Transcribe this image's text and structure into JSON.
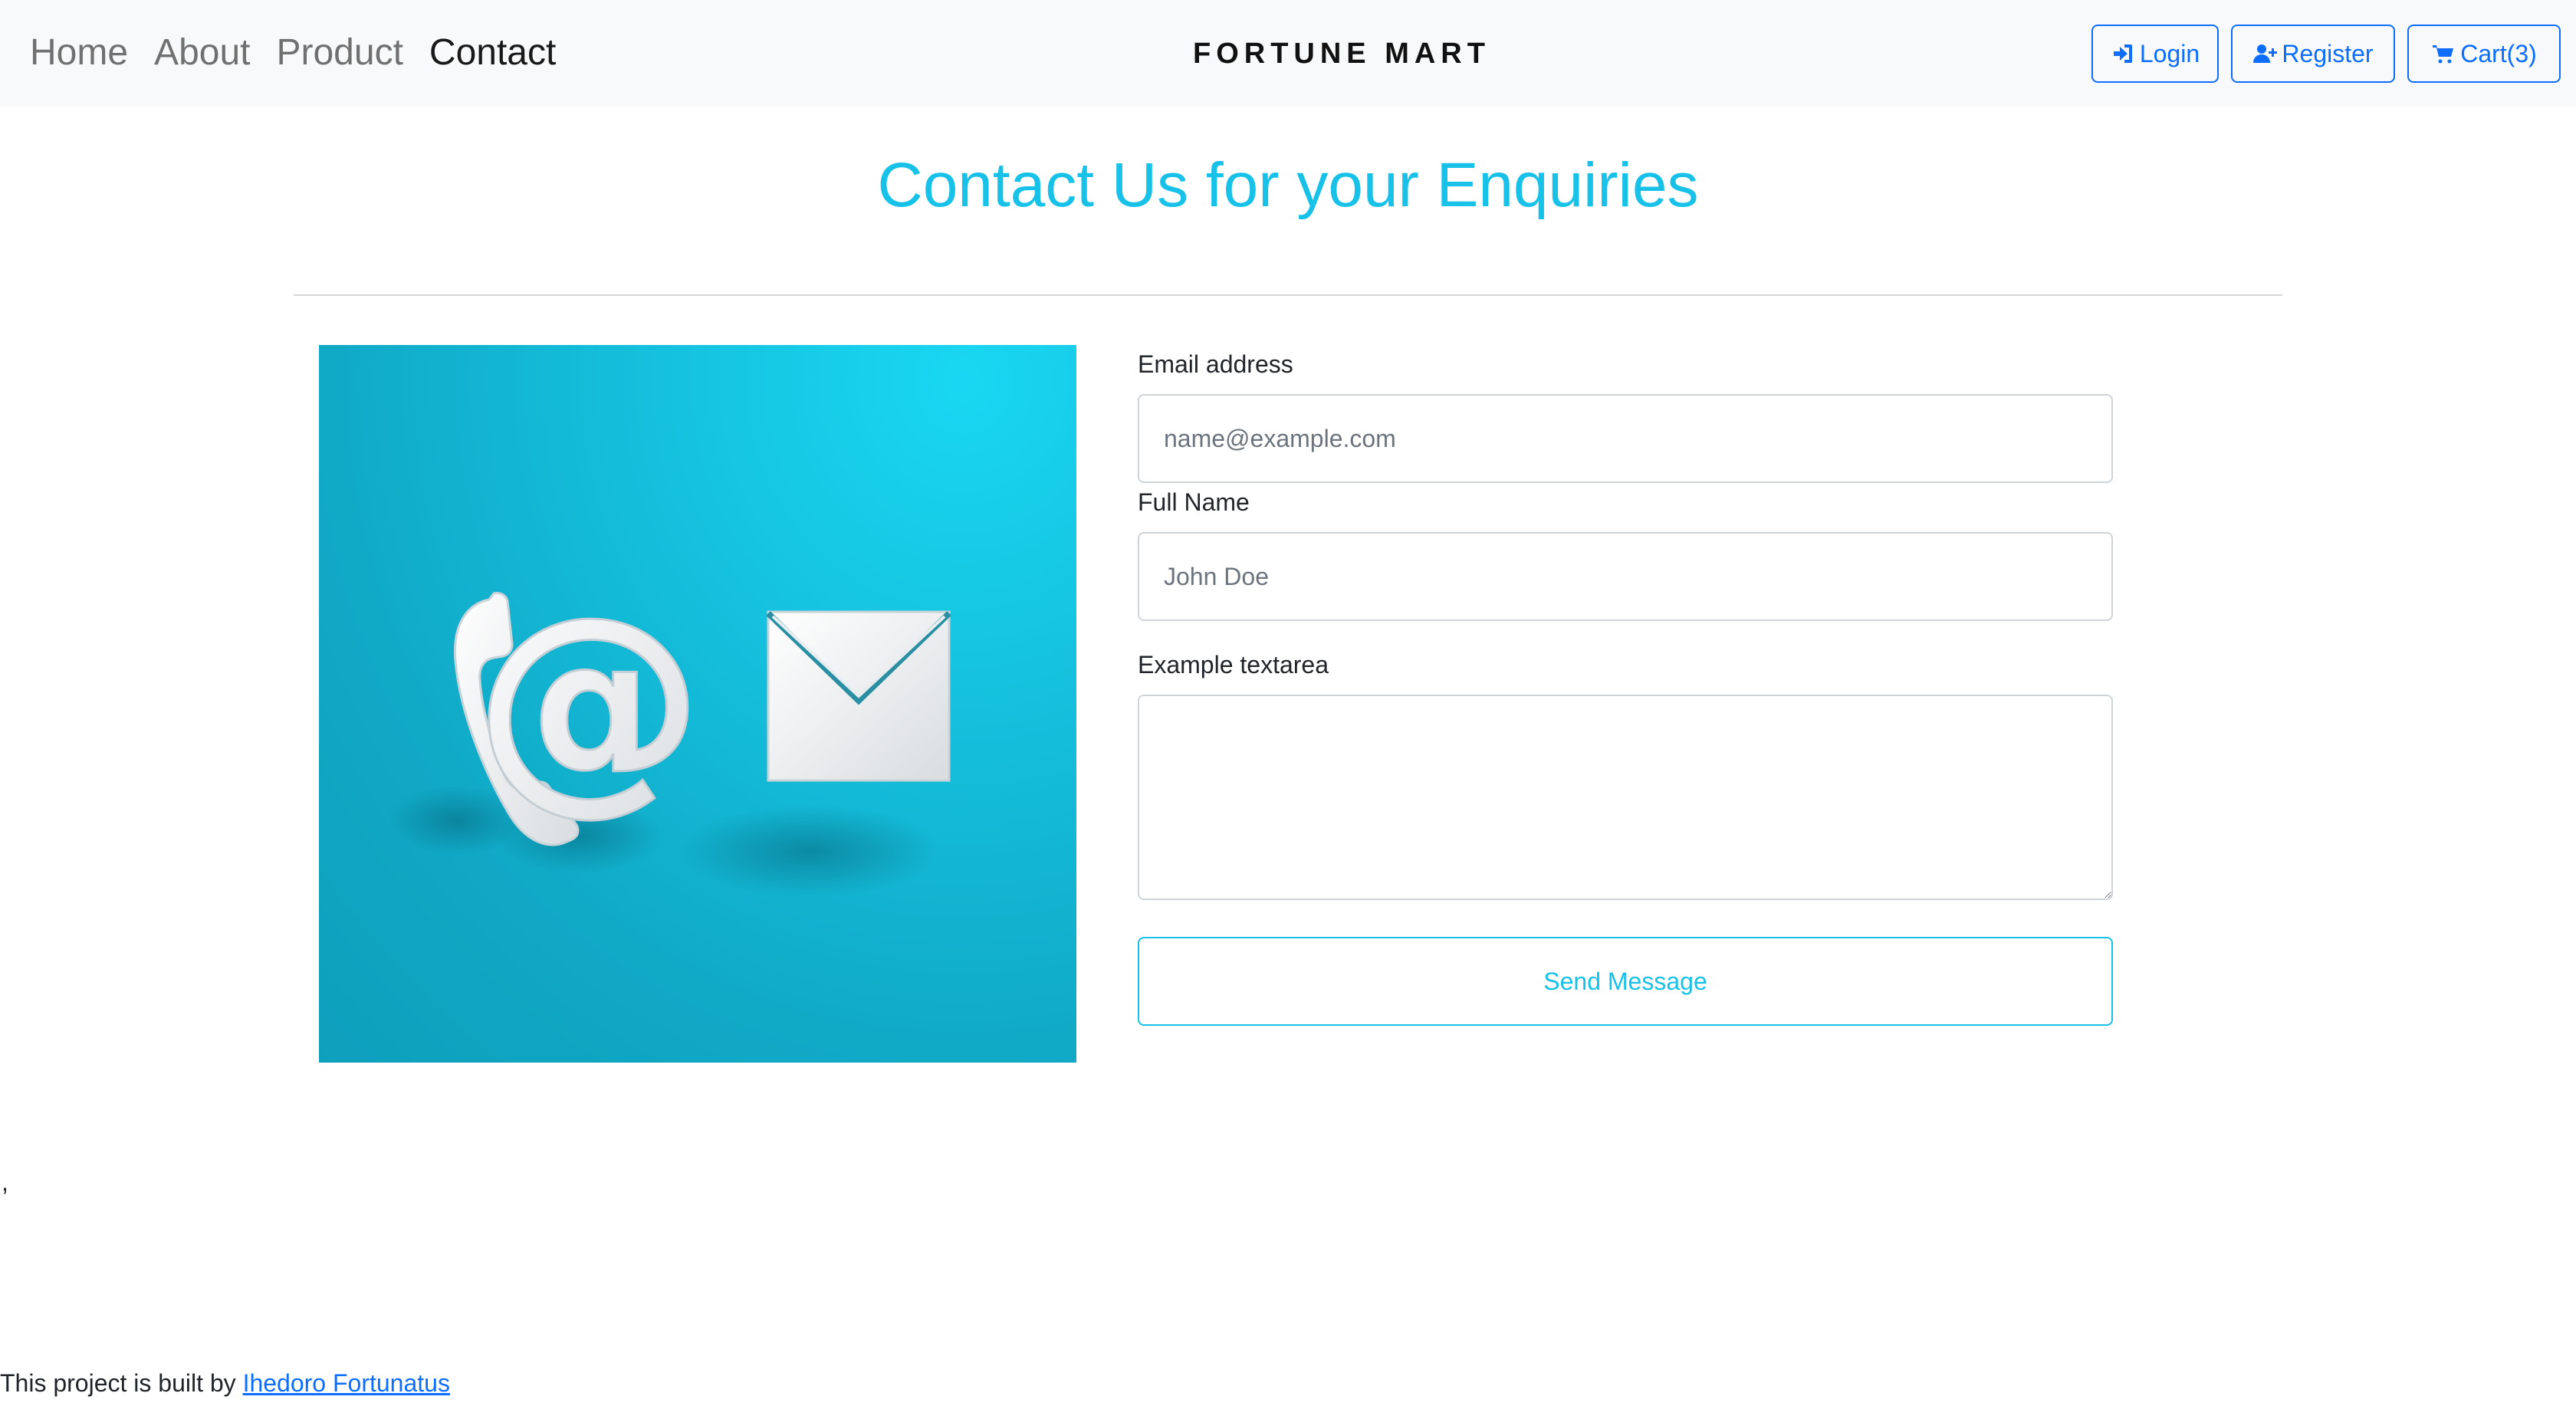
{
  "nav": {
    "links": [
      {
        "label": "Home",
        "active": false
      },
      {
        "label": "About",
        "active": false
      },
      {
        "label": "Product",
        "active": false
      },
      {
        "label": "Contact",
        "active": true
      }
    ],
    "brand": "FORTUNE MART",
    "buttons": {
      "login": {
        "label": "Login",
        "icon": "sign-in-icon"
      },
      "register": {
        "label": "Register",
        "icon": "user-plus-icon"
      },
      "cart": {
        "label": "Cart(3)",
        "icon": "shopping-cart-icon"
      }
    }
  },
  "page": {
    "title": "Contact Us for your Enquiries"
  },
  "image": {
    "description_icons": [
      "phone-icon",
      "at-sign-icon",
      "envelope-icon"
    ]
  },
  "form": {
    "email": {
      "label": "Email address",
      "placeholder": "name@example.com",
      "value": ""
    },
    "name": {
      "label": "Full Name",
      "placeholder": "John Doe",
      "value": ""
    },
    "message": {
      "label": "Example textarea",
      "value": ""
    },
    "submit_label": "Send Message"
  },
  "stray_text": ",",
  "footer": {
    "text": "This project is built by ",
    "link_label": "Ihedoro Fortunatus"
  },
  "colors": {
    "accent": "#17c1e8",
    "primary": "#0d6efd",
    "navbar_bg": "#f8f9fa"
  }
}
